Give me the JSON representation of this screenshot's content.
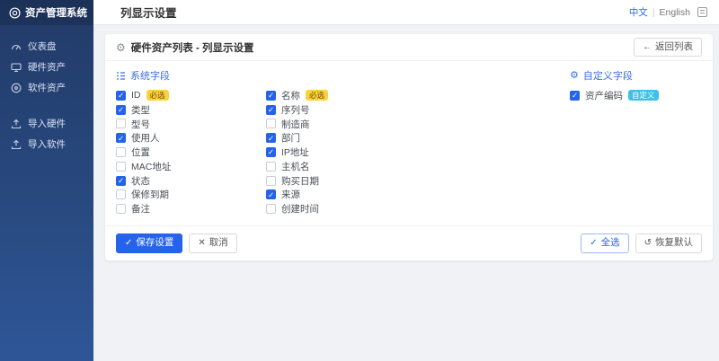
{
  "app": {
    "logo_title": "资产管理系统"
  },
  "sidebar": {
    "items": [
      {
        "label": "仪表盘",
        "icon": "dashboard-icon"
      },
      {
        "label": "硬件资产",
        "icon": "hardware-icon"
      },
      {
        "label": "软件资产",
        "icon": "software-icon"
      },
      {
        "label": "导入硬件",
        "icon": "upload-icon"
      },
      {
        "label": "导入软件",
        "icon": "upload-icon"
      }
    ]
  },
  "topbar": {
    "title": "列显示设置",
    "lang_zh": "中文",
    "lang_sep": "|",
    "lang_en": "English"
  },
  "card": {
    "title": "硬件资产列表 - 列显示设置",
    "gear_glyph": "⚙",
    "back_button": {
      "icon": "←",
      "label": "返回列表"
    }
  },
  "fields": {
    "system": {
      "title": "系统字段",
      "columns": [
        [
          {
            "label": "ID",
            "checked": true,
            "badge": "必选",
            "badge_type": "required"
          },
          {
            "label": "类型",
            "checked": true
          },
          {
            "label": "型号",
            "checked": false
          },
          {
            "label": "使用人",
            "checked": true
          },
          {
            "label": "位置",
            "checked": false
          },
          {
            "label": "MAC地址",
            "checked": false
          },
          {
            "label": "状态",
            "checked": true
          },
          {
            "label": "保修到期",
            "checked": false
          },
          {
            "label": "备注",
            "checked": false
          }
        ],
        [
          {
            "label": "名称",
            "checked": true,
            "badge": "必选",
            "badge_type": "required"
          },
          {
            "label": "序列号",
            "checked": true
          },
          {
            "label": "制造商",
            "checked": false
          },
          {
            "label": "部门",
            "checked": true
          },
          {
            "label": "IP地址",
            "checked": true
          },
          {
            "label": "主机名",
            "checked": false
          },
          {
            "label": "购买日期",
            "checked": false
          },
          {
            "label": "来源",
            "checked": true
          },
          {
            "label": "创建时间",
            "checked": false
          }
        ]
      ]
    },
    "custom": {
      "title": "自定义字段",
      "gear_glyph": "⚙",
      "items": [
        {
          "label": "资产编码",
          "checked": true,
          "badge": "自定义",
          "badge_type": "custom"
        }
      ]
    }
  },
  "footer": {
    "save": {
      "icon": "✓",
      "label": "保存设置"
    },
    "cancel": {
      "icon": "✕",
      "label": "取消"
    },
    "select_all": {
      "icon": "✓",
      "label": "全选"
    },
    "restore": {
      "icon": "↺",
      "label": "恢复默认"
    }
  },
  "colors": {
    "accent_blue": "#2563eb",
    "section_blue": "#3b6fe0",
    "badge_required_bg": "#fbd23c",
    "badge_custom_bg": "#3ec1e6",
    "sidebar_top": "#223a68",
    "sidebar_bottom": "#2e5697",
    "content_bg": "#f0f2f5"
  },
  "check_glyph": "✓"
}
